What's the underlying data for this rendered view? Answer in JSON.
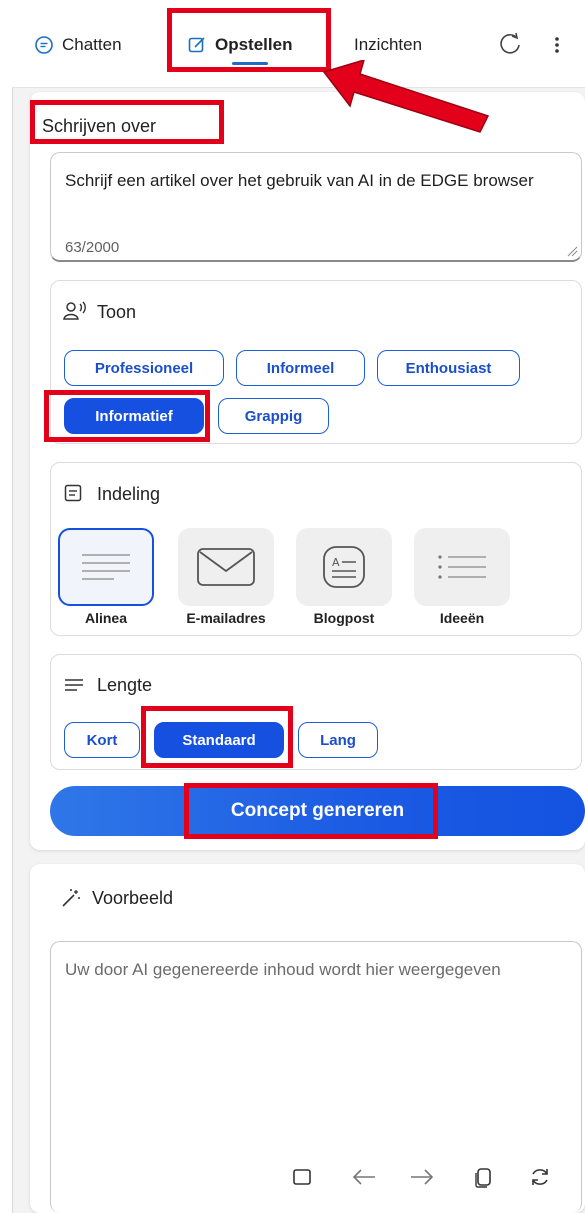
{
  "tabs": [
    {
      "label": "Chatten",
      "icon": "chat-icon"
    },
    {
      "label": "Opstellen",
      "icon": "compose-icon",
      "active": true
    },
    {
      "label": "Inzichten"
    }
  ],
  "compose": {
    "section_title": "Schrijven over",
    "prompt_value": "Schrijf een artikel over het gebruik van AI in de EDGE browser",
    "char_count": "63/2000"
  },
  "tone": {
    "title": "Toon",
    "options": [
      "Professioneel",
      "Informeel",
      "Enthousiast",
      "Informatief",
      "Grappig"
    ],
    "selected": "Informatief"
  },
  "format": {
    "title": "Indeling",
    "options": [
      "Alinea",
      "E-mailadres",
      "Blogpost",
      "Ideeën"
    ],
    "selected": "Alinea"
  },
  "length": {
    "title": "Lengte",
    "options": [
      "Kort",
      "Standaard",
      "Lang"
    ],
    "selected": "Standaard"
  },
  "generate_label": "Concept genereren",
  "preview": {
    "title": "Voorbeeld",
    "placeholder": "Uw door AI gegenereerde inhoud wordt hier weergegeven"
  },
  "colors": {
    "accent": "#1550e0",
    "annotation": "#e3001b"
  }
}
